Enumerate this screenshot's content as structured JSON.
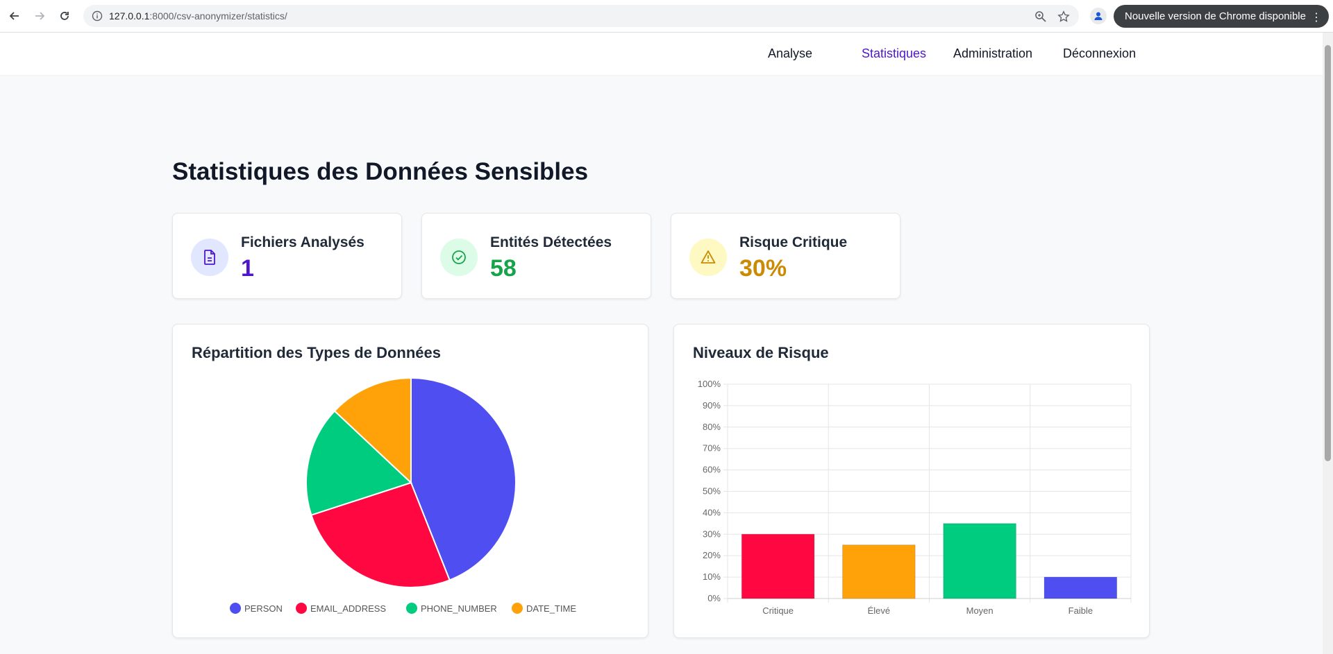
{
  "browser": {
    "url_host": "127.0.0.1",
    "url_rest": ":8000/csv-anonymizer/statistics/",
    "update_label": "Nouvelle version de Chrome disponible"
  },
  "nav": {
    "items": [
      {
        "label": "Analyse",
        "active": false
      },
      {
        "label": "Statistiques",
        "active": true
      },
      {
        "label": "Administration",
        "active": false
      },
      {
        "label": "Déconnexion",
        "active": false
      }
    ]
  },
  "page": {
    "title": "Statistiques des Données Sensibles"
  },
  "stats": [
    {
      "label": "Fichiers Analysés",
      "value": "1",
      "icon": "document-icon",
      "color": "#4f16c9",
      "bg": "#e0e7ff"
    },
    {
      "label": "Entités Détectées",
      "value": "58",
      "icon": "check-circle-icon",
      "color": "#16a34a",
      "bg": "#dcfce7"
    },
    {
      "label": "Risque Critique",
      "value": "30%",
      "icon": "warning-icon",
      "color": "#ca8a04",
      "bg": "#fef9c3"
    }
  ],
  "pie_panel": {
    "title": "Répartition des Types de Données"
  },
  "bar_panel": {
    "title": "Niveaux de Risque"
  },
  "chart_data": [
    {
      "type": "pie",
      "categories": [
        "PERSON",
        "EMAIL_ADDRESS",
        "PHONE_NUMBER",
        "DATE_TIME"
      ],
      "values": [
        44,
        26,
        17,
        13
      ],
      "colors": [
        "#4f4ef0",
        "#ff0842",
        "#00cc80",
        "#ffa20a"
      ],
      "legend": "bottom"
    },
    {
      "type": "bar",
      "categories": [
        "Critique",
        "Élevé",
        "Moyen",
        "Faible"
      ],
      "values": [
        30,
        25,
        35,
        10
      ],
      "colors": [
        "#ff0842",
        "#ffa20a",
        "#00cc80",
        "#4f4ef0"
      ],
      "ylim": [
        0,
        100
      ],
      "yticks": [
        "0%",
        "10%",
        "20%",
        "30%",
        "40%",
        "50%",
        "60%",
        "70%",
        "80%",
        "90%",
        "100%"
      ],
      "grid": true
    }
  ]
}
